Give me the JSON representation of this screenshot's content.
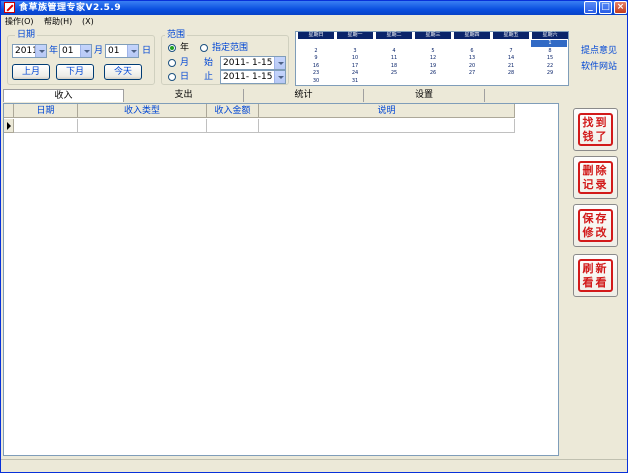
{
  "window": {
    "title": "食草族管理专家V2.5.9"
  },
  "menu": [
    {
      "label": "操作(O)"
    },
    {
      "label": "帮助(H)"
    },
    {
      "label": "(X)"
    }
  ],
  "date_group": {
    "title": "日期",
    "year": "2011",
    "year_suffix": "年",
    "month": "01",
    "month_suffix": "月",
    "day": "01",
    "day_suffix": "日",
    "prev_month": "上月",
    "next_month": "下月",
    "today": "今天"
  },
  "range_group": {
    "title": "范围",
    "opt_year": "年",
    "opt_custom": "指定范围",
    "opt_month": "月",
    "opt_day": "日",
    "start_label": "始",
    "end_label": "止",
    "start_date": "2011- 1-15",
    "end_date": "2011- 1-15",
    "selected": "年"
  },
  "calendar": {
    "headers": [
      "星期日",
      "星期一",
      "星期二",
      "星期三",
      "星期四",
      "星期五",
      "星期六"
    ],
    "weeks": [
      [
        "",
        "",
        "",
        "",
        "",
        "",
        "1"
      ],
      [
        "2",
        "3",
        "4",
        "5",
        "6",
        "7",
        "8"
      ],
      [
        "9",
        "10",
        "11",
        "12",
        "13",
        "14",
        "15"
      ],
      [
        "16",
        "17",
        "18",
        "19",
        "20",
        "21",
        "22"
      ],
      [
        "23",
        "24",
        "25",
        "26",
        "27",
        "28",
        "29"
      ],
      [
        "30",
        "31",
        "",
        "",
        "",
        "",
        ""
      ]
    ],
    "selected_day": "1"
  },
  "links": {
    "feedback": "提点意见",
    "website": "软件网站"
  },
  "tabs": [
    {
      "label": "收入"
    },
    {
      "label": "支出"
    },
    {
      "label": "统计"
    },
    {
      "label": "设置"
    }
  ],
  "grid": {
    "columns": [
      "日期",
      "收入类型",
      "收入金额",
      "说明"
    ]
  },
  "side_buttons": [
    {
      "line1": "找到",
      "line2": "钱了"
    },
    {
      "line1": "删除",
      "line2": "记录"
    },
    {
      "line1": "保存",
      "line2": "修改"
    },
    {
      "line1": "刷新",
      "line2": "看看"
    }
  ],
  "colors": {
    "titlebar": "#0a4fe0",
    "seal_red": "#d21a1a",
    "label_blue": "#0046d5",
    "calendar_header": "#0a246a"
  }
}
